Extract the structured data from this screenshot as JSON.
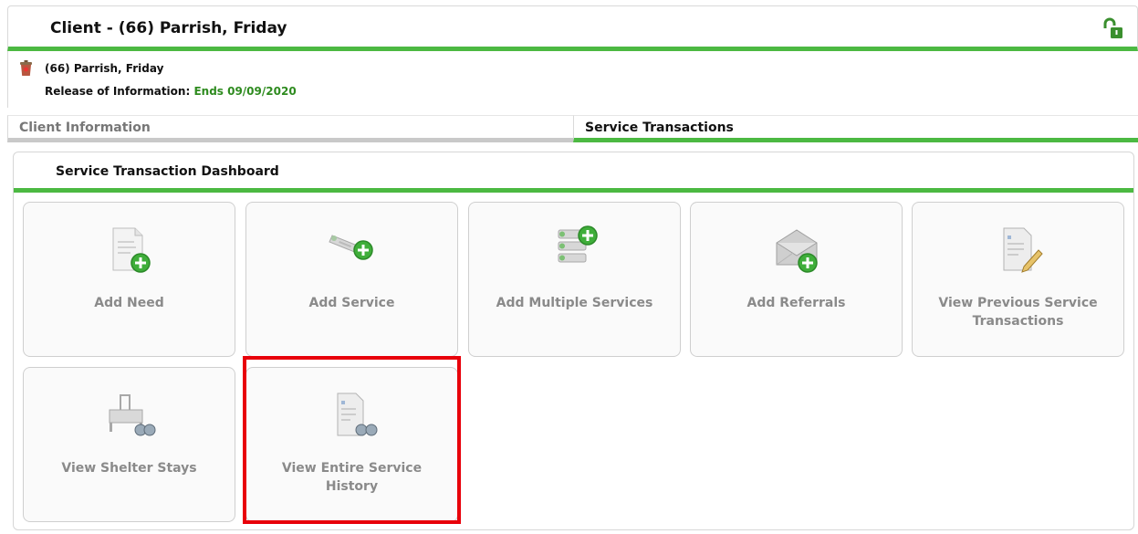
{
  "header": {
    "title": "Client - (66) Parrish, Friday",
    "lock_icon": "unlock-icon"
  },
  "client": {
    "name": "(66) Parrish, Friday",
    "roi_label": "Release of Information:",
    "roi_value": "Ends 09/09/2020"
  },
  "tabs": [
    {
      "label": "Client Information",
      "active": false
    },
    {
      "label": "Service Transactions",
      "active": true
    }
  ],
  "dashboard": {
    "title": "Service Transaction Dashboard",
    "tiles": [
      {
        "label": "Add Need",
        "icon": "add-need-icon"
      },
      {
        "label": "Add Service",
        "icon": "add-service-icon"
      },
      {
        "label": "Add Multiple Services",
        "icon": "add-multiple-services-icon"
      },
      {
        "label": "Add Referrals",
        "icon": "add-referrals-icon"
      },
      {
        "label": "View Previous Service Transactions",
        "icon": "view-previous-transactions-icon"
      },
      {
        "label": "View Shelter Stays",
        "icon": "view-shelter-stays-icon"
      },
      {
        "label": "View Entire Service History",
        "icon": "view-entire-history-icon"
      }
    ]
  },
  "colors": {
    "accent": "#4cb942",
    "highlight": "#e8000a",
    "tile_text": "#8a8a8a"
  }
}
